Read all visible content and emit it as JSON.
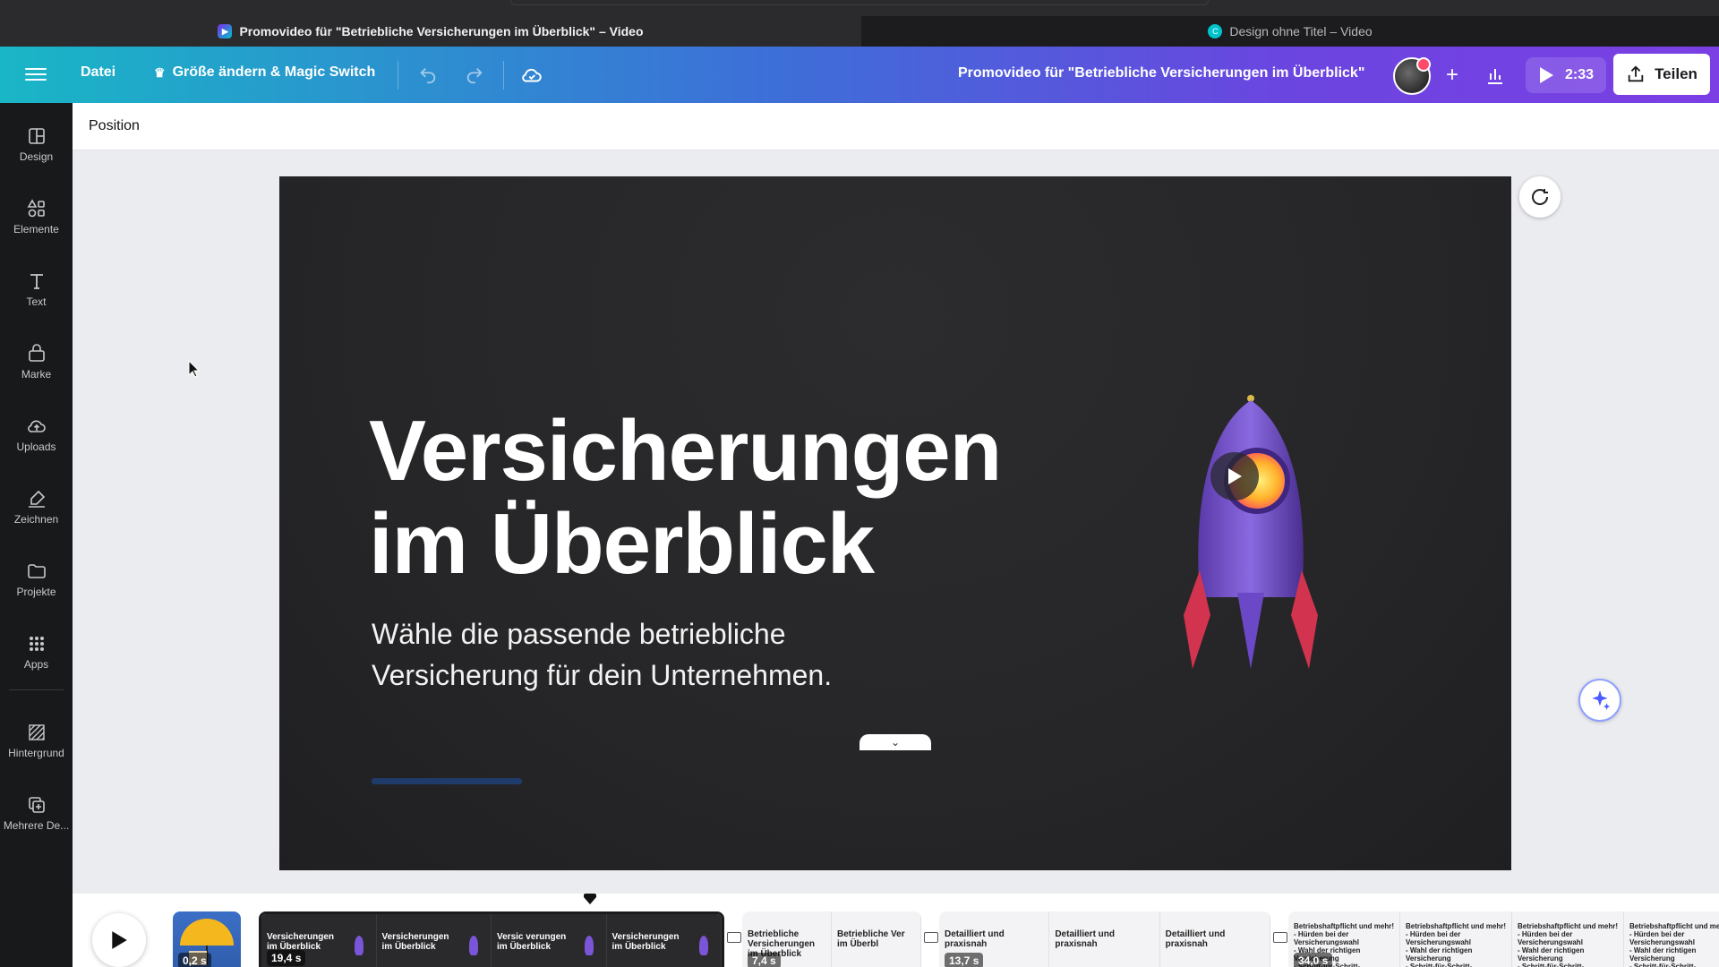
{
  "browser": {
    "tabs": [
      {
        "title": "Promovideo für \"Betriebliche Versicherungen im Überblick\" – Video"
      },
      {
        "title": "Design ohne Titel – Video"
      }
    ]
  },
  "header": {
    "file_label": "Datei",
    "resize_label": "Größe ändern & Magic Switch",
    "doc_title": "Promovideo für \"Betriebliche Versicherungen im Überblick\"",
    "duration": "2:33",
    "share_label": "Teilen",
    "colors": {
      "gradient_start": "#19b6c6",
      "gradient_end": "#7b3fe4"
    }
  },
  "sidebar": {
    "items": [
      {
        "label": "Design",
        "icon": "layout-icon"
      },
      {
        "label": "Elemente",
        "icon": "shapes-icon"
      },
      {
        "label": "Text",
        "icon": "text-icon"
      },
      {
        "label": "Marke",
        "icon": "brand-icon"
      },
      {
        "label": "Uploads",
        "icon": "cloud-upload-icon"
      },
      {
        "label": "Zeichnen",
        "icon": "draw-icon"
      },
      {
        "label": "Projekte",
        "icon": "folder-icon"
      },
      {
        "label": "Apps",
        "icon": "apps-grid-icon"
      },
      {
        "label": "Hintergrund",
        "icon": "background-icon"
      },
      {
        "label": "Mehrere De...",
        "icon": "duplicate-icon"
      }
    ]
  },
  "context_toolbar": {
    "position_label": "Position"
  },
  "slide": {
    "title": "Versicherungen\nim Überblick",
    "subtitle": "Wähle die passende betriebliche\nVersicherung für dein Unternehmen."
  },
  "timeline": {
    "clips": [
      {
        "badge": "0,2 s"
      },
      {
        "badge": "19,4 s",
        "frames": [
          "Versicherungen\nim Überblick",
          "Versicherungen\nim Überblick",
          "Versic verungen\nim Überblick",
          "Versicherungen\nim Überblick"
        ]
      },
      {
        "badge": "7,4 s",
        "frames": [
          "Betriebliche Versicherungen\nim Überblick",
          "Betriebliche Ver\nim Überbl"
        ]
      },
      {
        "badge": "13,7 s",
        "frames": [
          "Detailliert und praxisnah",
          "Detailliert und praxisnah",
          "Detailliert und praxisnah"
        ]
      },
      {
        "badge": "34,0 s",
        "frames": [
          "Betriebshaftpflicht und mehr!\n- Hürden bei der Versicherungswahl\n- Wahl der richtigen Versicherung\n- Schritt-für-Schritt-Anleitungen",
          "Betriebshaftpflicht und mehr!\n- Hürden bei der Versicherungswahl\n- Wahl der richtigen Versicherung\n- Schritt-für-Schritt-Anleitungen",
          "Betriebshaftpflicht und mehr!\n- Hürden bei der Versicherungswahl\n- Wahl der richtigen Versicherung\n- Schritt-für-Schritt-Anleitungen",
          "Betriebshaftpflicht und mehr!\n- Hürden bei der Versicherungswahl\n- Wahl der richtigen Versicherung\n- Schritt-für-Schritt-Anleitungen"
        ]
      }
    ]
  }
}
